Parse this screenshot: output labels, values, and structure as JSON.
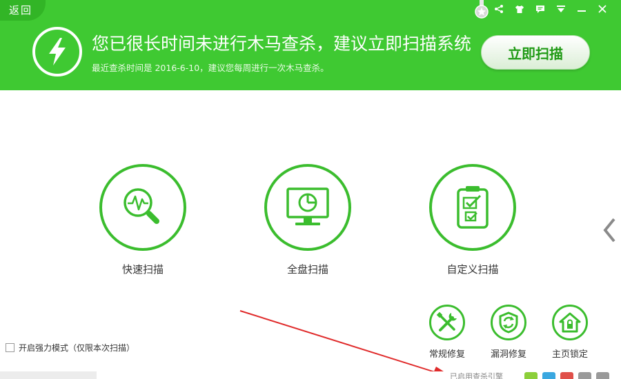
{
  "header": {
    "back_label": "返回",
    "headline": "您已很长时间未进行木马查杀，建议立即扫描系统",
    "subline": "最近查杀时间是 2016-6-10，建议您每周进行一次木马查杀。",
    "scan_now_label": "立即扫描",
    "top_icons": [
      "share-icon",
      "skin-shirt-icon",
      "feedback-icon",
      "menu-icon",
      "minimize-icon",
      "close-icon"
    ]
  },
  "scan_options": [
    {
      "label": "快速扫描",
      "icon": "magnifier-pulse-icon"
    },
    {
      "label": "全盘扫描",
      "icon": "monitor-icon"
    },
    {
      "label": "自定义扫描",
      "icon": "checklist-icon"
    }
  ],
  "tools": [
    {
      "label": "常规修复",
      "icon": "wrench-screwdriver-icon"
    },
    {
      "label": "漏洞修复",
      "icon": "shield-refresh-icon"
    },
    {
      "label": "主页锁定",
      "icon": "home-lock-icon"
    }
  ],
  "strong_mode": {
    "label": "开启强力模式（仅限本次扫描）",
    "checked": false
  },
  "footer": {
    "text": "已启用查杀引擎",
    "engine_colors": [
      "#8ccf3a",
      "#3aa7e0",
      "#e0504a",
      "#9a9a9a",
      "#9a9a9a"
    ]
  },
  "colors": {
    "brand_green": "#3fc932",
    "ring_green": "#3bbd2e",
    "annotation_red": "#e02b2b"
  }
}
